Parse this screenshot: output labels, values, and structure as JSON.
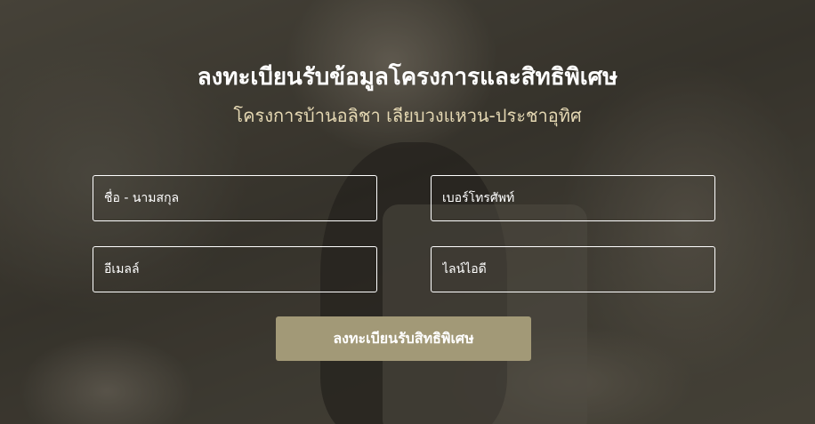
{
  "header": {
    "title": "ลงทะเบียนรับข้อมูลโครงการและสิทธิพิเศษ",
    "subtitle": "โครงการบ้านอลิชา เลียบวงแหวน-ประชาอุทิศ"
  },
  "form": {
    "name_placeholder": "ชื่อ - นามสกุล",
    "phone_placeholder": "เบอร์โทรศัพท์",
    "email_placeholder": "อีเมลล์",
    "line_placeholder": "ไลน์ไอดี",
    "submit_label": "ลงทะเบียนรับสิทธิพิเศษ"
  },
  "colors": {
    "accent_button": "#a29977",
    "subtitle_text": "#e5d8b3",
    "field_border": "#ffffff"
  }
}
